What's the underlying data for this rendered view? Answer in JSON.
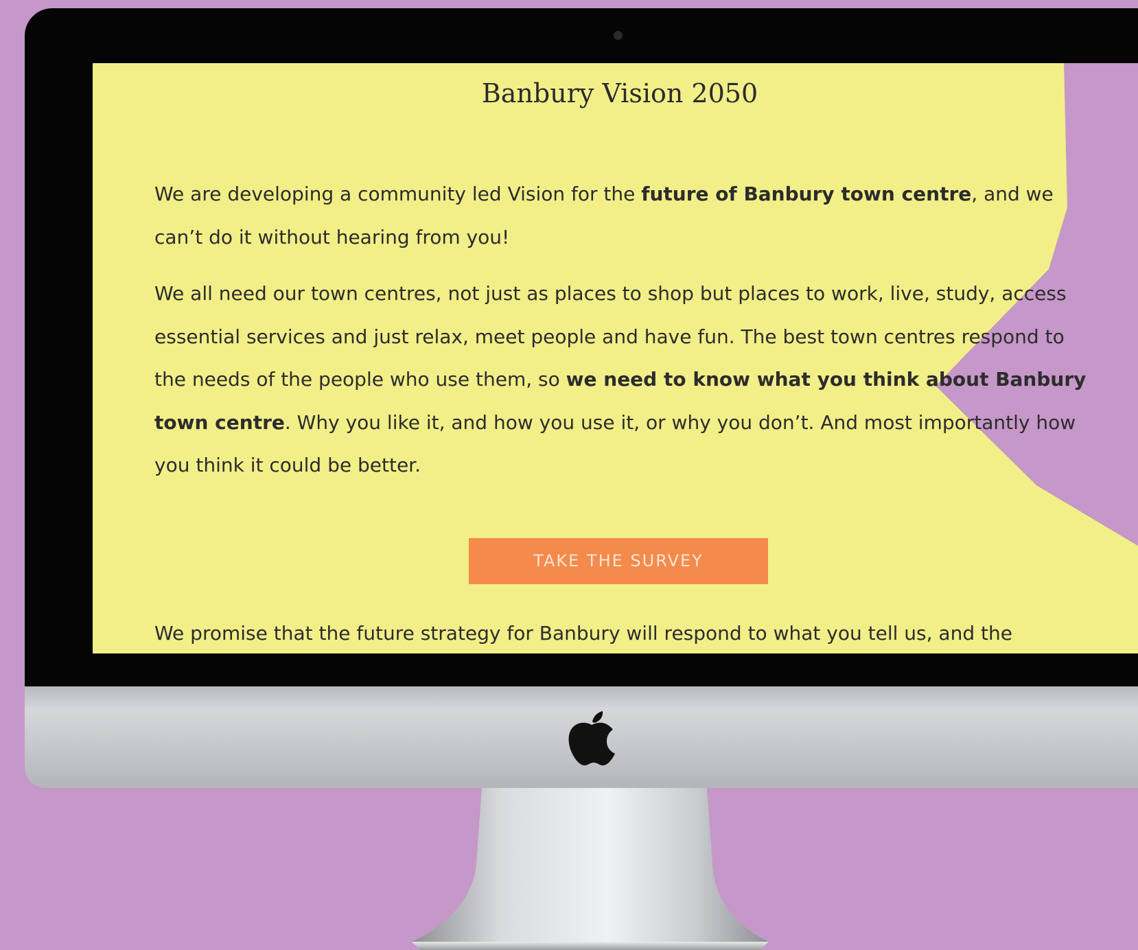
{
  "screen": {
    "title": "Banbury Vision 2050",
    "paragraph1": {
      "text_before": "We are developing a community led Vision for the ",
      "bold": "future of Banbury town centre",
      "text_after": ", and we can’t do it without hearing from you!"
    },
    "paragraph2": {
      "text_before": "We all need our town centres, not just as places to shop but places to work, live, study, access essential services and just relax, meet people and have fun. The best town centres respond to the needs of the people who use them, so ",
      "bold": "we need to know what you think about Banbury town centre",
      "text_after": ". Why you like it, and how you use it, or why you don’t. And most importantly how you think it could be better."
    },
    "survey_button_label": "TAKE THE SURVEY",
    "paragraph3": "We promise that the future strategy for Banbury will respond to what you tell us, and the"
  },
  "colors": {
    "page_background": "#c697c9",
    "screen_background": "#f2ef88",
    "accent_purple": "#c697c9",
    "button_background": "#f48a4b",
    "button_text": "#fde6d1",
    "body_text": "#2c2c2c"
  },
  "icons": {
    "monitor_logo": "apple-logo-icon",
    "camera": "camera-dot"
  }
}
